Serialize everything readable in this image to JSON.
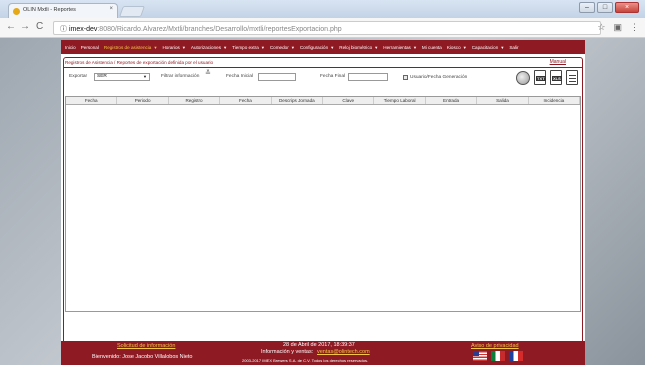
{
  "browser": {
    "tab_title": "OLIN Mxtli - Reportes",
    "tab_close": "×",
    "address_host": "imex-dev",
    "address_path": ":8080/Ricardo.Alvarez/Mxtli/branches/Desarrollo/mxtli/reportesExportacion.php",
    "nav_back": "←",
    "nav_forward": "→",
    "nav_reload": "C",
    "bookmark_star": "☆",
    "menu_dots": "⋮"
  },
  "menu": {
    "items": [
      {
        "label": "Inicio",
        "caret": false,
        "active": false
      },
      {
        "label": "Personal",
        "caret": false,
        "active": false
      },
      {
        "label": "Registros de asistencia",
        "caret": true,
        "active": true
      },
      {
        "label": "Horarios",
        "caret": true,
        "active": false
      },
      {
        "label": "Autorizaciones",
        "caret": true,
        "active": false
      },
      {
        "label": "Tiempo extra",
        "caret": true,
        "active": false
      },
      {
        "label": "Comedor",
        "caret": true,
        "active": false
      },
      {
        "label": "Configuración",
        "caret": true,
        "active": false
      },
      {
        "label": "Reloj biométrico",
        "caret": true,
        "active": false
      },
      {
        "label": "Herramientas",
        "caret": true,
        "active": false
      },
      {
        "label": "Mi cuenta",
        "caret": false,
        "active": false
      },
      {
        "label": "Kiosco",
        "caret": true,
        "active": false
      },
      {
        "label": "Capacitacion",
        "caret": true,
        "active": false
      },
      {
        "label": "Salir",
        "caret": false,
        "active": false
      }
    ]
  },
  "content": {
    "breadcrumb": "Registros de Asistencia / Reportes de exportación definida por el usuario",
    "manual_link": "Manual"
  },
  "filters": {
    "exportar_label": "Exportar",
    "exportar_value": "SER",
    "filtrar_label": "Filtrar información",
    "fecha_inicial_label": "Fecha Inicial",
    "fecha_final_label": "Fecha Final",
    "usuario_fecha_label": "Usuario/Fecha Generación"
  },
  "export_icons": [
    "globe-icon",
    "txt-icon",
    "xls-icon",
    "doc-icon"
  ],
  "export_tags": {
    "txt": "TXT",
    "xls": "XLS"
  },
  "table": {
    "columns": [
      "Fecha",
      "Periodo",
      "Registro",
      "Fecha",
      "Descrips Jornada",
      "Clave",
      "Tiempo Laboral",
      "Entrada",
      "Salida",
      "Incidencia"
    ]
  },
  "footer": {
    "solicitud_link": "Solicitud de información",
    "welcome": "Bienvenido: Jose Jacobo Villalobos Nieto",
    "datetime": "28 de Abril de 2017, 18:39:37",
    "info_ventas_label": "Información y ventas:",
    "info_ventas_email": "ventas@olintech.com",
    "copyright": "2003-2017 IMEX Brewers S.A. de C.V. Todos los derechos reservados.",
    "privacy_link": "Aviso de privacidad"
  }
}
